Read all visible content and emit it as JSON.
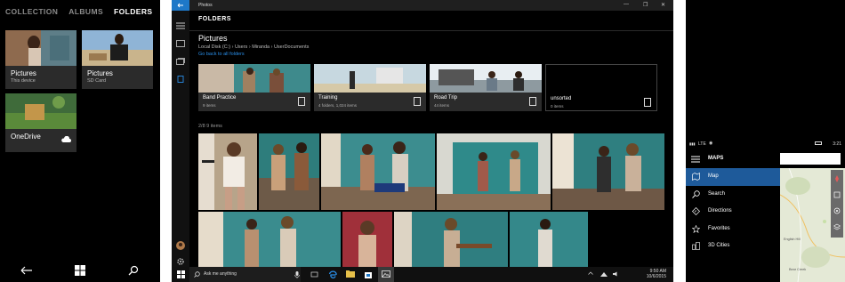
{
  "left_phone": {
    "pivot": [
      "COLLECTION",
      "ALBUMS",
      "FOLDERS"
    ],
    "active_pivot": "FOLDERS",
    "tiles": [
      {
        "title": "Pictures",
        "subtitle": "This device"
      },
      {
        "title": "Pictures",
        "subtitle": "SD Card"
      },
      {
        "title": "OneDrive",
        "subtitle": ""
      }
    ],
    "nav": [
      "back-icon",
      "windows-icon",
      "search-icon"
    ]
  },
  "desktop": {
    "window_title": "Photos",
    "window_controls": [
      "—",
      "❐",
      "✕"
    ],
    "section": "FOLDERS",
    "folder_title": "Pictures",
    "breadcrumb": "Local Disk (C:)  ›  Users  ›  Miranda  ›  UserDocuments",
    "go_back": "Go back to all folders",
    "folders": [
      {
        "name": "Band Practice",
        "sub": "9 items"
      },
      {
        "name": "Training",
        "sub": "4 folders, 1,024 items"
      },
      {
        "name": "Road Trip",
        "sub": "44 items"
      },
      {
        "name": "unsorted",
        "sub": "0 items"
      }
    ],
    "item_count": "2/8    9 items",
    "taskbar": {
      "search_placeholder": "Ask me anything",
      "time": "9:50 AM",
      "date": "10/6/2015"
    }
  },
  "right_phone": {
    "status": {
      "left": "LTE",
      "right": "3:21"
    },
    "title": "MAPS",
    "menu": [
      "Map",
      "Search",
      "Directions",
      "Favorites",
      "3D Cities"
    ],
    "selected": "Map",
    "map_labels": [
      "English Hill",
      "Bear Creek"
    ]
  },
  "colors": {
    "accent": "#1e78c8",
    "selected_menu": "#1e5a9a",
    "link": "#2a8ee8"
  }
}
